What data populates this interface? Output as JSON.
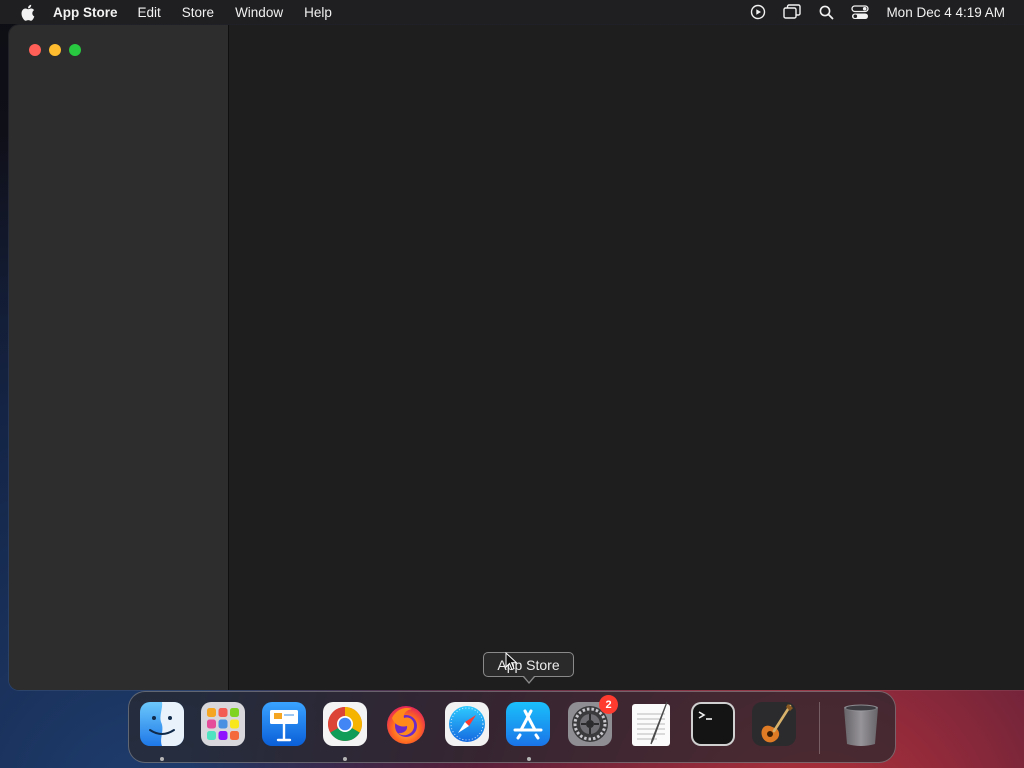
{
  "menubar": {
    "apple_icon": "apple-logo-icon",
    "app_name": "App Store",
    "menus": [
      "Edit",
      "Store",
      "Window",
      "Help"
    ],
    "status_icons": [
      "screen-recording-icon",
      "screen-mirroring-icon",
      "spotlight-search-icon",
      "control-center-icon"
    ],
    "clock": "Mon Dec 4  4:19 AM"
  },
  "window": {
    "traffic_lights": {
      "close": "#ff5f57",
      "minimize": "#febc2e",
      "zoom": "#28c840"
    }
  },
  "tooltip": {
    "text": "App Store"
  },
  "dock": {
    "items": [
      {
        "name": "Finder",
        "icon": "finder-icon",
        "running": true
      },
      {
        "name": "Launchpad",
        "icon": "launchpad-icon",
        "running": false
      },
      {
        "name": "Keynote",
        "icon": "keynote-icon",
        "running": false
      },
      {
        "name": "Google Chrome",
        "icon": "chrome-icon",
        "running": true
      },
      {
        "name": "Firefox",
        "icon": "firefox-icon",
        "running": false
      },
      {
        "name": "Safari",
        "icon": "safari-icon",
        "running": false
      },
      {
        "name": "App Store",
        "icon": "app-store-icon",
        "running": true
      },
      {
        "name": "System Settings",
        "icon": "system-settings-icon",
        "running": false,
        "badge": "2"
      },
      {
        "name": "TextEdit",
        "icon": "textedit-icon",
        "running": false
      },
      {
        "name": "Terminal",
        "icon": "terminal-icon",
        "running": false
      },
      {
        "name": "GarageBand",
        "icon": "garageband-icon",
        "running": false
      },
      {
        "name": "Trash",
        "icon": "trash-icon",
        "running": false
      }
    ]
  }
}
